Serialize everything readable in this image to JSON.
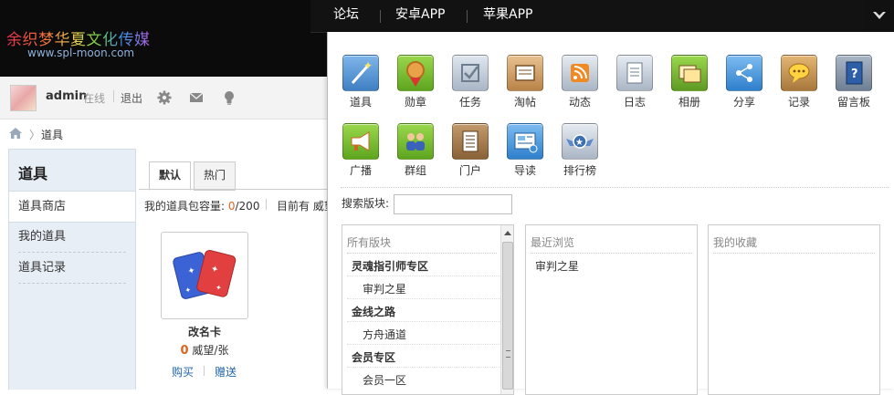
{
  "header": {
    "logo_text": "余织梦华夏文化传媒",
    "logo_url": "www.spl-moon.com",
    "topnav": [
      "论坛",
      "安卓APP",
      "苹果APP"
    ]
  },
  "user": {
    "name": "admin",
    "status": "在线",
    "logout": "退出"
  },
  "breadcrumb": {
    "current": "道具"
  },
  "sidebar": {
    "title": "道具",
    "items": [
      {
        "label": "道具商店",
        "active": true
      },
      {
        "label": "我的道具",
        "active": false
      },
      {
        "label": "道具记录",
        "active": false
      }
    ]
  },
  "main": {
    "tabs": [
      {
        "label": "默认",
        "active": true
      },
      {
        "label": "热门",
        "active": false
      }
    ],
    "capacity_label": "我的道具包容量: ",
    "capacity_used": "0",
    "capacity_total": "/200",
    "has_text": "目前有 威望",
    "item": {
      "name": "改名卡",
      "price": "0",
      "unit": " 威望/张",
      "buy": "购买",
      "gift": "赠送"
    }
  },
  "panel": {
    "apps": [
      {
        "label": "道具",
        "icon": "magic-wand-icon",
        "color": "#4a8ac8"
      },
      {
        "label": "勋章",
        "icon": "medal-icon",
        "color": "#6fb82a"
      },
      {
        "label": "任务",
        "icon": "task-icon",
        "color": "#a9b6c6"
      },
      {
        "label": "淘帖",
        "icon": "tray-icon",
        "color": "#c48e54"
      },
      {
        "label": "动态",
        "icon": "rss-icon",
        "color": "#a9b6c6"
      },
      {
        "label": "日志",
        "icon": "journal-icon",
        "color": "#a9b6c6"
      },
      {
        "label": "相册",
        "icon": "album-icon",
        "color": "#6ba82b"
      },
      {
        "label": "分享",
        "icon": "share-icon",
        "color": "#3f8fd4"
      },
      {
        "label": "记录",
        "icon": "speech-bubble-icon",
        "color": "#b8864a"
      },
      {
        "label": "留言板",
        "icon": "guestbook-icon",
        "color": "#3a6fb0"
      },
      {
        "label": "广播",
        "icon": "megaphone-icon",
        "color": "#6fb82a"
      },
      {
        "label": "群组",
        "icon": "group-icon",
        "color": "#6fb82a"
      },
      {
        "label": "门户",
        "icon": "portal-icon",
        "color": "#8a6238"
      },
      {
        "label": "导读",
        "icon": "guide-icon",
        "color": "#3f8fd4"
      },
      {
        "label": "排行榜",
        "icon": "ranking-icon",
        "color": "#a9b6c6"
      }
    ],
    "search_label": "搜索版块:",
    "search_value": "",
    "all_forums": {
      "title": "所有版块",
      "groups": [
        {
          "name": "灵魂指引师专区",
          "children": [
            "审判之星"
          ]
        },
        {
          "name": "金线之路",
          "children": [
            "方舟通道"
          ]
        },
        {
          "name": "会员专区",
          "children": [
            "会员一区"
          ]
        }
      ]
    },
    "recent": {
      "title": "最近浏览",
      "items": [
        "审判之星"
      ]
    },
    "favorites": {
      "title": "我的收藏",
      "items": []
    }
  }
}
